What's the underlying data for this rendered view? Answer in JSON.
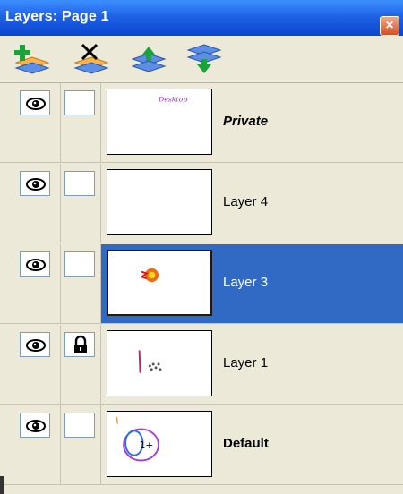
{
  "window": {
    "title": "Layers: Page 1"
  },
  "toolbar": {
    "buttons": [
      {
        "icon": "add-layer-icon"
      },
      {
        "icon": "delete-layer-icon"
      },
      {
        "icon": "move-layer-up-icon"
      },
      {
        "icon": "move-layer-down-icon"
      }
    ]
  },
  "layers": [
    {
      "name": "Private",
      "visible": true,
      "locked": false,
      "selected": false,
      "style": "bold-italic",
      "thumb_text": "Desktop"
    },
    {
      "name": "Layer 4",
      "visible": true,
      "locked": false,
      "selected": false,
      "style": "normal"
    },
    {
      "name": "Layer 3",
      "visible": true,
      "locked": false,
      "selected": true,
      "style": "normal"
    },
    {
      "name": "Layer 1",
      "visible": true,
      "locked": true,
      "selected": false,
      "style": "normal"
    },
    {
      "name": "Default",
      "visible": true,
      "locked": false,
      "selected": false,
      "style": "bold",
      "thumb_text": "1+"
    }
  ],
  "colors": {
    "title_bar": "#0a46cf",
    "selection": "#316ac5",
    "panel": "#ece9d8",
    "close_button": "#d45022"
  }
}
